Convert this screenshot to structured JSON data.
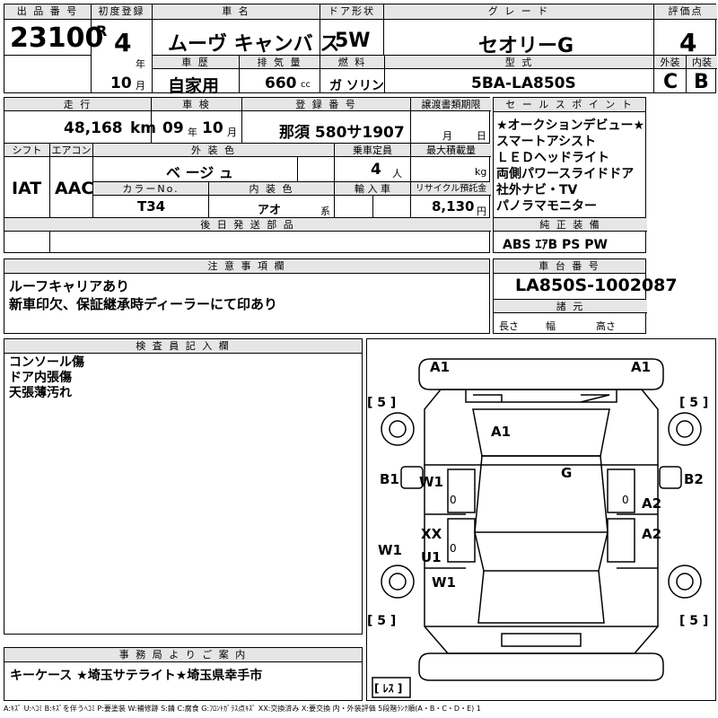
{
  "header": {
    "lot_no_label": "出 品 番 号",
    "lot_no": "23100",
    "first_reg_label": "初度登録",
    "era_mark": "R",
    "year": "4",
    "year_unit": "年",
    "month": "10",
    "month_unit": "月",
    "car_name_label": "車 名",
    "car_name": "ムーヴ キャンバ ス",
    "door_label": "ドア形状",
    "door": "5W",
    "grade_label": "グ レ ー ド",
    "grade": "セオリーG",
    "score_label": "評価点",
    "score": "4",
    "history_label": "車 歴",
    "history": "自家用",
    "displacement_label": "排 気 量",
    "displacement": "660",
    "displacement_unit": "cc",
    "fuel_label": "燃 料",
    "fuel": "ガ ソリン",
    "model_label": "型 式",
    "model": "5BA-LA850S",
    "exterior_label": "外装",
    "exterior": "C",
    "interior_label": "内装",
    "interior": "B"
  },
  "details": {
    "mileage_label": "走 行",
    "mileage": "48,168",
    "mileage_unit": "km",
    "inspection_label": "車 検",
    "insp_year": "09",
    "insp_year_unit": "年",
    "insp_month": "10",
    "insp_month_unit": "月",
    "reg_no_label": "登 録 番 号",
    "reg_no": "那須 580サ1907",
    "transfer_label": "譲渡書類期限",
    "transfer_month_unit": "月",
    "transfer_day_unit": "日",
    "shift_label": "シフト",
    "shift": "IAT",
    "ac_label": "エアコン",
    "ac": "AAC",
    "color_label": "外 装 色",
    "color": "ベ ージ ュ",
    "capacity_label": "乗車定員",
    "capacity": "4",
    "capacity_unit": "人",
    "load_label": "最大積載量",
    "load_unit": "kg",
    "color_no_label": "カラーNo.",
    "color_no": "T34",
    "int_color_label": "内 装 色",
    "int_color": "アオ",
    "int_color_unit": "系",
    "import_label": "輸 入 車",
    "recycle_label": "リサイクル預託金",
    "recycle": "8,130",
    "recycle_unit": "円",
    "later_parts_label": "後 日 発 送 部 品"
  },
  "sales_points": {
    "label": "セ ー ル ス ポ イ ン ト",
    "items": [
      "★オークションデビュー★",
      "スマートアシスト",
      "ＬＥＤヘッドライト",
      "両側パワースライドドア",
      "社外ナビ・TV",
      "パノラマモニター"
    ]
  },
  "equipment": {
    "label": "純 正 装 備",
    "value": "ABS  ｴｱB  PS  PW"
  },
  "notes": {
    "label": "注 意 事 項 欄",
    "lines": [
      "ルーフキャリアあり",
      "新車印欠、保証継承時ディーラーにて印あり"
    ]
  },
  "chassis": {
    "label": "車 台 番 号",
    "value": "LA850S-1002087",
    "specs_label": "諸 元",
    "length_label": "長さ",
    "width_label": "幅",
    "height_label": "高さ"
  },
  "inspector": {
    "label": "検 査 員 記 入 欄",
    "lines": [
      "コンソール傷",
      "ドア内張傷",
      "天張薄汚れ"
    ]
  },
  "diagram": {
    "marks": [
      "A1",
      "A1",
      "A1",
      "G",
      "B1",
      "W1",
      "A2",
      "B2",
      "XX",
      "U1",
      "A2",
      "W1",
      "W1"
    ],
    "tire_left_top": "[ 5 ]",
    "tire_right_top": "[ 5 ]",
    "tire_left_bottom": "[ 5 ]",
    "tire_right_bottom": "[ 5 ]",
    "spare": "[ ﾚｽ ]",
    "zero_marks": [
      "0",
      "0",
      "0"
    ]
  },
  "office": {
    "label": "事 務 局 よ り ご 案 内",
    "text": "キーケース  ★埼玉サテライト★埼玉県幸手市"
  },
  "legend": "A:ｷｽﾞ  U:ﾍｺﾐ  B:ｷｽﾞを伴うﾍｺﾐ  P:要塗装  W:補修跡  S:錆  C:腐食  G:ﾌﾛﾝﾄｶﾞﾗｽ点ｷｽﾞ  XX:交換済み  X:要交換   内・外装評価  5段階ﾗﾝｸ順(A・B・C・D・E)  1"
}
